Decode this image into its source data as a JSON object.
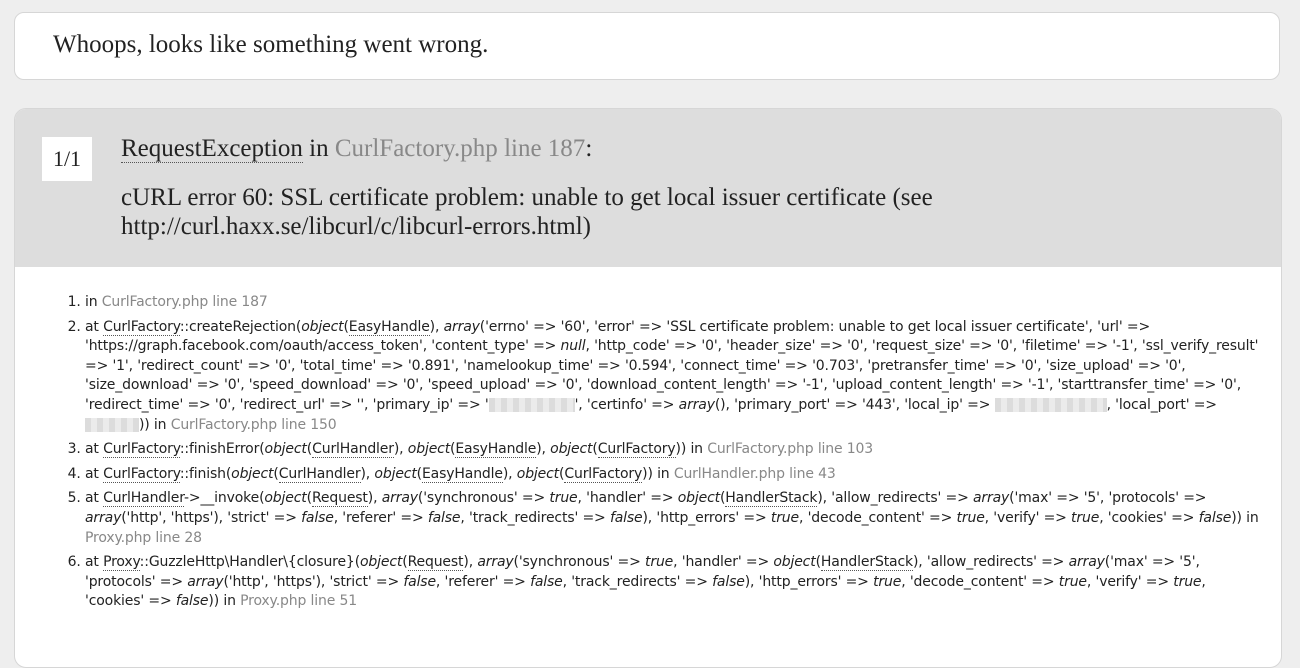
{
  "headline": "Whoops, looks like something went wrong.",
  "counter": "1/1",
  "exception": {
    "class": "RequestException",
    "in_word": " in ",
    "file": "CurlFactory.php",
    "line": " line 187",
    "colon": ":",
    "message": "cURL error 60: SSL certificate problem: unable to get local issuer certificate (see http://curl.haxx.se/libcurl/c/libcurl-errors.html)"
  },
  "trace": [
    {
      "file": "CurlFactory.php",
      "line": "line 187"
    },
    {
      "class": "CurlFactory",
      "method": "createRejection",
      "file": "CurlFactory.php",
      "line": "line 150"
    },
    {
      "class": "CurlFactory",
      "method": "finishError",
      "file": "CurlFactory.php",
      "line": "line 103"
    },
    {
      "class": "CurlFactory",
      "method": "finish",
      "file": "CurlHandler.php",
      "line": "line 43"
    },
    {
      "class": "CurlHandler",
      "method": "__invoke",
      "file": "Proxy.php",
      "line": "line 28"
    },
    {
      "class": "Proxy",
      "method": "GuzzleHttp\\Handler\\{closure}",
      "file": "Proxy.php",
      "line": "line 51"
    }
  ]
}
